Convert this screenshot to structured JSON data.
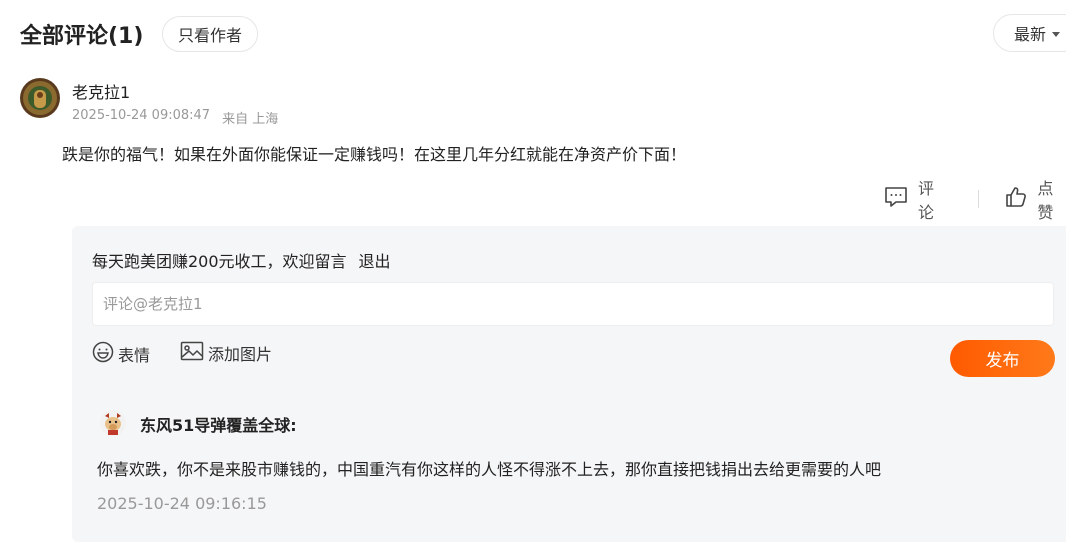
{
  "header": {
    "title": "全部评论(1)",
    "author_only_label": "只看作者",
    "sort_label": "最新"
  },
  "comment": {
    "username": "老克拉1",
    "timestamp": "2025-10-24 09:08:47",
    "location": "来自 上海",
    "content": "跌是你的福气！如果在外面你能保证一定赚钱吗！在这里几年分红就能在净资产价下面！",
    "actions": {
      "comment_label": "评论",
      "like_label": "点赞"
    }
  },
  "reply_box": {
    "welcome_text": "每天跑美团赚200元收工，欢迎留言",
    "logout_label": "退出",
    "input_placeholder": "评论@老克拉1",
    "emoji_label": "表情",
    "add_image_label": "添加图片",
    "publish_label": "发布"
  },
  "reply": {
    "username": "东风51导弹覆盖全球:",
    "content": "你喜欢跌，你不是来股市赚钱的，中国重汽有你这样的人怪不得涨不上去，那你直接把钱捐出去给更需要的人吧",
    "timestamp": "2025-10-24 09:16:15"
  },
  "icons": {
    "comment": "comment-bubble-icon",
    "like": "thumbs-up-icon",
    "emoji": "smiley-icon",
    "image": "image-icon",
    "sort": "chevron-down-icon"
  },
  "colors": {
    "accent": "#ff5a00",
    "panel_bg": "#f5f6f7",
    "muted": "#999999"
  }
}
